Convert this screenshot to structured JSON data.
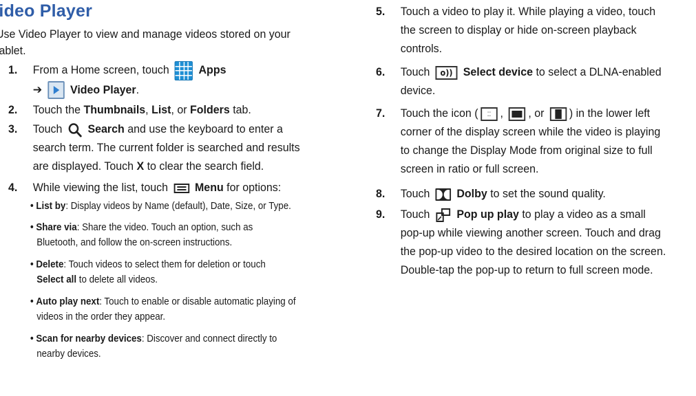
{
  "title": "Video Player",
  "intro": "Use Video Player to view and manage videos stored on your tablet.",
  "icons": {
    "apps": "apps-grid-icon",
    "video_player": "video-player-icon",
    "search": "search-icon",
    "menu": "menu-icon",
    "select_device": "select-device-icon",
    "display_original": "display-original-size-icon",
    "display_ratio": "display-full-ratio-icon",
    "display_full": "display-full-screen-icon",
    "dolby": "dolby-icon",
    "popup": "popup-play-icon"
  },
  "steps": {
    "s1": {
      "num": "1.",
      "t1": "From a Home screen, touch",
      "apps": "Apps",
      "arrow": "➔",
      "vp": "Video Player",
      "end": "."
    },
    "s2": {
      "num": "2.",
      "t1": "Touch the",
      "thumbs": "Thumbnails",
      "c1": ",",
      "list": "List",
      "c2": ", or",
      "folders": "Folders",
      "t2": "tab."
    },
    "s3": {
      "num": "3.",
      "t1": "Touch",
      "search": "Search",
      "t2": "and use the keyboard to enter a",
      "l2": "search term. The current folder is searched and results",
      "l3a": "are displayed. Touch",
      "x": "X",
      "l3b": "to clear the search field."
    },
    "s4": {
      "num": "4.",
      "t1": "While viewing the list, touch",
      "menu": "Menu",
      "t2": "for options:"
    },
    "s5": {
      "num": "5.",
      "l1": "Touch a video to play it. While playing a video, touch",
      "l2": "the screen to display or hide on-screen playback",
      "l3": "controls."
    },
    "s6": {
      "num": "6.",
      "t1": "Touch",
      "sel": "Select device",
      "t2": "to select a DLNA-enabled",
      "l2": "device."
    },
    "s7": {
      "num": "7.",
      "t1": "Touch the icon (",
      "c1": ",",
      "c2": ", or",
      "t2": ") in the lower left",
      "l2": "corner of the display screen while the video is playing",
      "l3": "to change the Display Mode from original size to full",
      "l4": "screen in ratio or full screen."
    },
    "s8": {
      "num": "8.",
      "t1": "Touch",
      "dolby": "Dolby",
      "t2": "to set the sound quality."
    },
    "s9": {
      "num": "9.",
      "t1": "Touch",
      "popup": "Pop up play",
      "t2": "to play a video as a small",
      "l2": "pop-up while viewing another screen. Touch and drag",
      "l3": "the pop-up video to the desired location on the screen.",
      "l4": "Double-tap the pop-up to return to full screen mode."
    }
  },
  "menu_options": {
    "bullet": "•",
    "list_by": {
      "label": "List by",
      "text": ": Display videos by Name (default), Date, Size, or Type."
    },
    "share": {
      "label": "Share via",
      "text": ": Share the video. Touch an option, such as",
      "l2": "Bluetooth, and follow the on-screen instructions."
    },
    "delete": {
      "label": "Delete",
      "text": ": Touch videos to select them for deletion or touch",
      "l2b": "Select all",
      "l2": " to delete all videos."
    },
    "auto": {
      "label": "Auto play next",
      "text": ": Touch to enable or disable automatic playing of",
      "l2": "videos in the order they appear."
    },
    "scan": {
      "label": "Scan for nearby devices",
      "text": ": Discover and connect directly to",
      "l2": "nearby devices."
    }
  },
  "device_icon_text": "o))",
  "disp_icon_text": "⁚⁚"
}
